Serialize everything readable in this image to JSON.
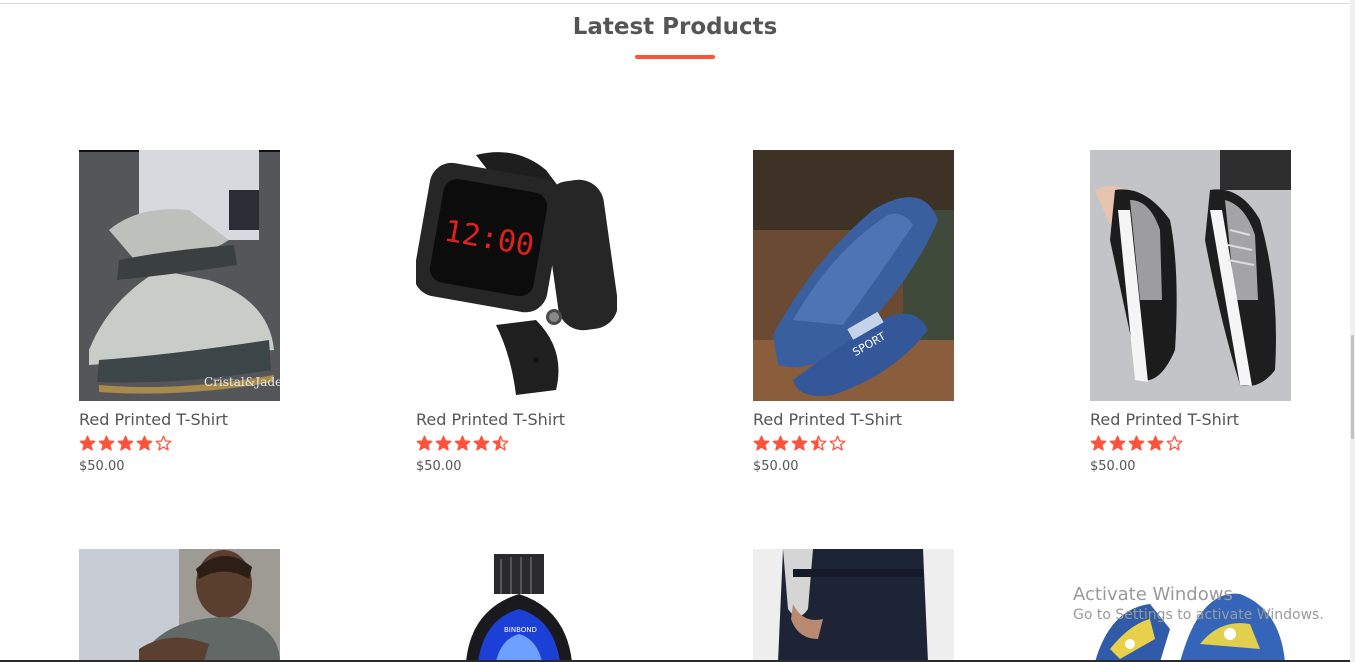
{
  "section": {
    "title": "Latest Products",
    "accent_color": "#ff523b"
  },
  "products": [
    {
      "name": "Red Printed T-Shirt",
      "rating": 4,
      "price": "$50.00",
      "image": "sneakers-grey-photo"
    },
    {
      "name": "Red Printed T-Shirt",
      "rating": 4.5,
      "price": "$50.00",
      "image": "smart-watch-photo"
    },
    {
      "name": "Red Printed T-Shirt",
      "rating": 3.5,
      "price": "$50.00",
      "image": "blue-loafers-photo"
    },
    {
      "name": "Red Printed T-Shirt",
      "rating": 4,
      "price": "$50.00",
      "image": "black-sneakers-photo"
    },
    {
      "image": "man-portrait-photo"
    },
    {
      "image": "steel-watch-photo"
    },
    {
      "image": "jeans-photo"
    },
    {
      "image": "printed-sneakers-photo"
    }
  ],
  "watermark": {
    "title": "Activate Windows",
    "subtitle": "Go to Settings to activate Windows."
  }
}
